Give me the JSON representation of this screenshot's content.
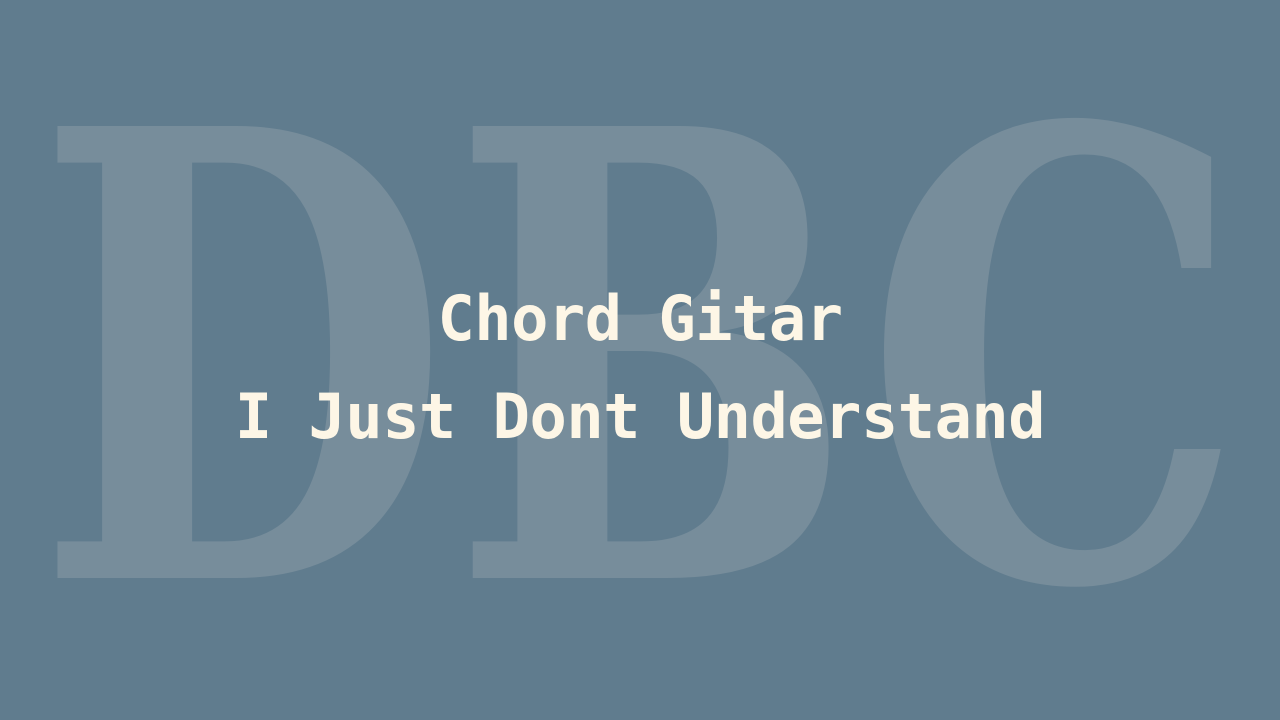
{
  "watermark": {
    "text": "DBC"
  },
  "title": {
    "line1": "Chord Gitar",
    "line2": "I Just Dont Understand"
  },
  "colors": {
    "background": "#607c8e",
    "watermark": "#778d9b",
    "title": "#fdf6e6"
  }
}
